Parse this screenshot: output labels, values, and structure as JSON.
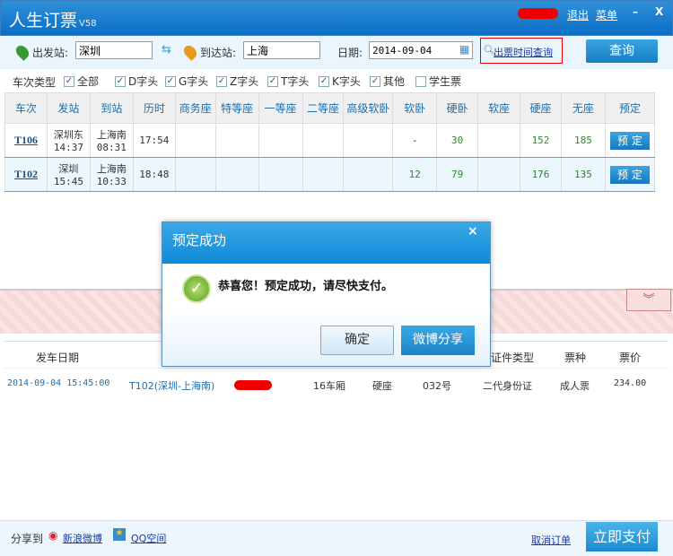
{
  "app": {
    "title": "人生订票",
    "version": "V58",
    "logout": "退出",
    "menu": "菜单",
    "minimize": "–",
    "close": "X"
  },
  "search": {
    "from_label": "出发站:",
    "from_value": "深圳",
    "to_label": "到达站:",
    "to_value": "上海",
    "date_label": "日期:",
    "date_value": "2014-09-04",
    "ticket_time_link": "出票时间查询",
    "query_button": "查询"
  },
  "filters": {
    "label": "车次类型",
    "items": [
      {
        "label": "全部",
        "checked": true
      },
      {
        "label": "D字头",
        "checked": true
      },
      {
        "label": "G字头",
        "checked": true
      },
      {
        "label": "Z字头",
        "checked": true
      },
      {
        "label": "T字头",
        "checked": true
      },
      {
        "label": "K字头",
        "checked": true
      },
      {
        "label": "其他",
        "checked": true
      },
      {
        "label": "学生票",
        "checked": false
      }
    ]
  },
  "table": {
    "headers": [
      "车次",
      "发站",
      "到站",
      "历时",
      "商务座",
      "特等座",
      "一等座",
      "二等座",
      "高级软卧",
      "软卧",
      "硬卧",
      "软座",
      "硬座",
      "无座",
      "预定"
    ],
    "rows": [
      {
        "train": "T106",
        "from": "深圳东",
        "dep": "14:37",
        "to": "上海南",
        "arr": "08:31",
        "duration": "17:54",
        "soft_sleeper": "-",
        "hard_sleeper": "30",
        "hard_seat": "152",
        "no_seat": "185",
        "book": "预 定"
      },
      {
        "train": "T102",
        "from": "深圳",
        "dep": "15:45",
        "to": "上海南",
        "arr": "10:33",
        "duration": "18:48",
        "soft_sleeper": "12",
        "hard_sleeper": "79",
        "hard_seat": "176",
        "no_seat": "135",
        "book": "预 定"
      }
    ]
  },
  "order": {
    "headers": {
      "date": "发车日期",
      "id_type": "证件类型",
      "ticket_type": "票种",
      "price": "票价"
    },
    "row": {
      "date": "2014-09-04 15:45:00",
      "train": "T102(深圳-上海南)",
      "car": "16车厢",
      "seat_class": "硬座",
      "seat_no": "032号",
      "id_type": "二代身份证",
      "ticket_type": "成人票",
      "price": "234.00"
    }
  },
  "footer": {
    "share_label": "分享到",
    "weibo": "新浪微博",
    "qzone": "QQ空间",
    "cancel": "取消订单",
    "pay": "立即支付"
  },
  "dialog": {
    "title": "预定成功",
    "close": "×",
    "message": "恭喜您！预定成功，请尽快支付。",
    "ok": "确定",
    "share": "微博分享"
  }
}
